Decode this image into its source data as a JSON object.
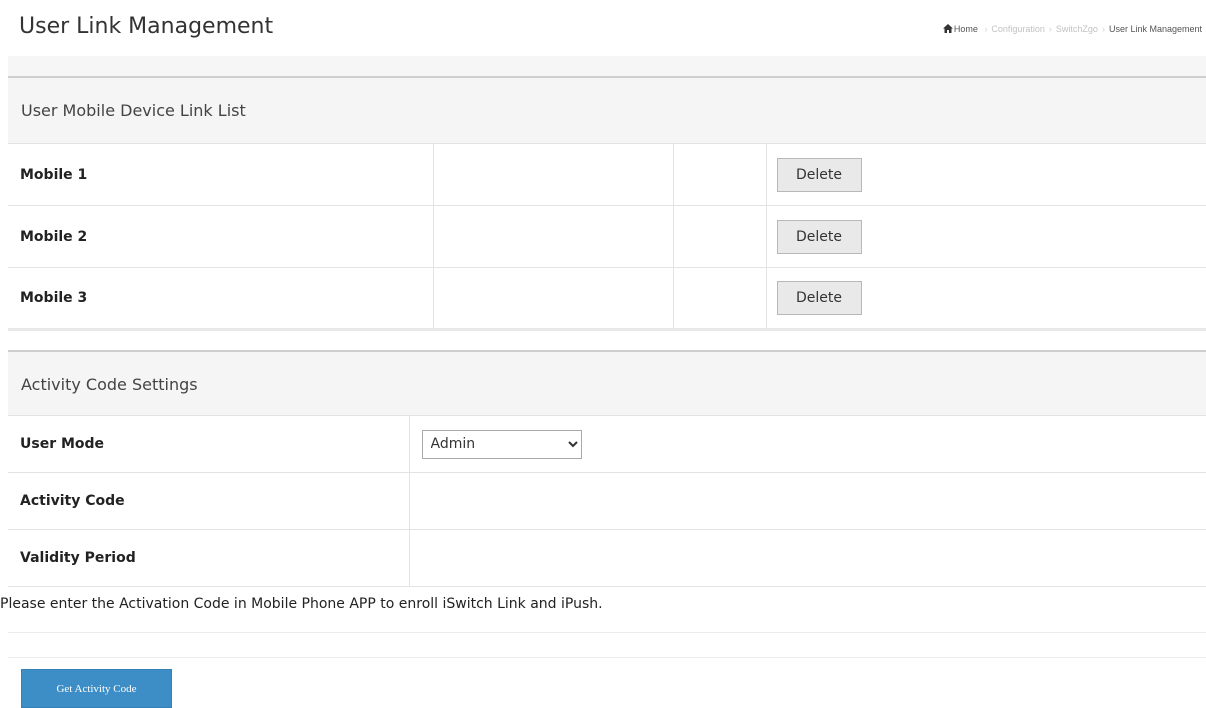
{
  "page": {
    "title": "User Link Management"
  },
  "breadcrumb": {
    "home": "Home",
    "items": [
      "Configuration",
      "SwitchZgo"
    ],
    "current": "User Link Management"
  },
  "device_list": {
    "heading": "User Mobile Device Link List",
    "rows": [
      {
        "label": "Mobile 1",
        "col2": "",
        "col3": "",
        "action": "Delete"
      },
      {
        "label": "Mobile 2",
        "col2": "",
        "col3": "",
        "action": "Delete"
      },
      {
        "label": "Mobile 3",
        "col2": "",
        "col3": "",
        "action": "Delete"
      }
    ]
  },
  "activity_settings": {
    "heading": "Activity Code Settings",
    "user_mode_label": "User Mode",
    "user_mode_value": "Admin",
    "activity_code_label": "Activity Code",
    "activity_code_value": "",
    "validity_period_label": "Validity Period",
    "validity_period_value": ""
  },
  "note": "Please enter the Activation Code in Mobile Phone APP to enroll iSwitch Link and iPush.",
  "actions": {
    "get_activity_code": "Get Activity Code"
  },
  "colors": {
    "primary_button": "#3d8ec6",
    "panel_header_bg": "#f5f5f5"
  },
  "icons": {
    "home": "home-icon"
  }
}
